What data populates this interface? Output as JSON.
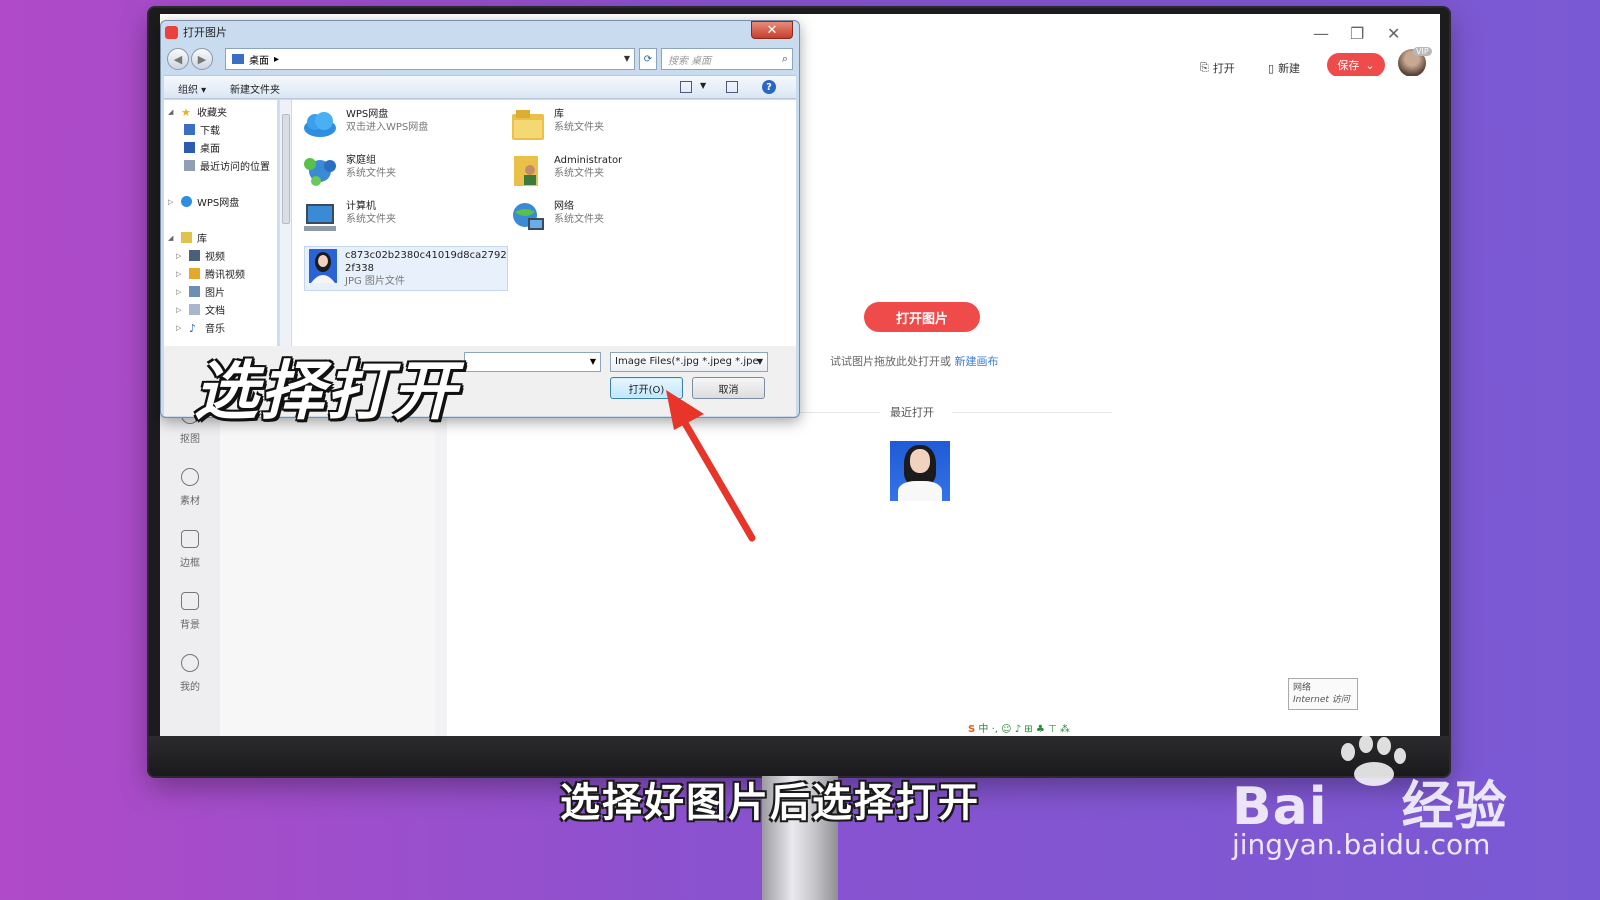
{
  "app": {
    "title_actions": {
      "open": "打开",
      "new": "新建",
      "save": "保存"
    },
    "vip": "VIP",
    "rail": [
      {
        "label": "抠图"
      },
      {
        "label": "素材"
      },
      {
        "label": "边框"
      },
      {
        "label": "背景"
      },
      {
        "label": "我的"
      }
    ],
    "open_image_button": "打开图片",
    "hint_text": "试试图片拖放此处打开或",
    "hint_link": "新建画布",
    "recent_title": "最近打开",
    "network_badge": {
      "line1": "网络",
      "line2": "Internet 访问"
    },
    "ime_bar": "中 ·, ☺ ♪ ⊞ ♣ ⊤ ⁂"
  },
  "dialog": {
    "title": "打开图片",
    "close": "✕",
    "address": "桌面",
    "search_placeholder": "搜索 桌面",
    "commands": {
      "organize": "组织 ▾",
      "new_folder": "新建文件夹"
    },
    "nav": {
      "favorites": "收藏夹",
      "downloads": "下载",
      "desktop": "桌面",
      "recent": "最近访问的位置",
      "wps_drive": "WPS网盘",
      "libraries": "库",
      "videos": "视频",
      "tencent_video": "腾讯视频",
      "pictures": "图片",
      "documents": "文档",
      "music": "音乐"
    },
    "files": [
      {
        "name": "WPS网盘",
        "sub": "双击进入WPS网盘"
      },
      {
        "name": "库",
        "sub": "系统文件夹"
      },
      {
        "name": "家庭组",
        "sub": "系统文件夹"
      },
      {
        "name": "Administrator",
        "sub": "系统文件夹"
      },
      {
        "name": "计算机",
        "sub": "系统文件夹"
      },
      {
        "name": "网络",
        "sub": "系统文件夹"
      },
      {
        "name": "c873c02b2380c41019d8ca2792",
        "name2": "2f338",
        "sub": "JPG 图片文件"
      }
    ],
    "file_type": "Image Files(*.jpg *.jpeg *.jpe",
    "open_button": "打开(O)",
    "cancel_button": "取消"
  },
  "overlay_caption": "选择打开",
  "subtitle": "选择好图片后选择打开",
  "watermark": {
    "brand_a": "Bai",
    "brand_b": "经验",
    "url": "jingyan.baidu.com"
  },
  "colors": {
    "accent": "#f04b4b",
    "link": "#3a7cd8",
    "arrow": "#e8352a",
    "background": "#8a52cf"
  }
}
